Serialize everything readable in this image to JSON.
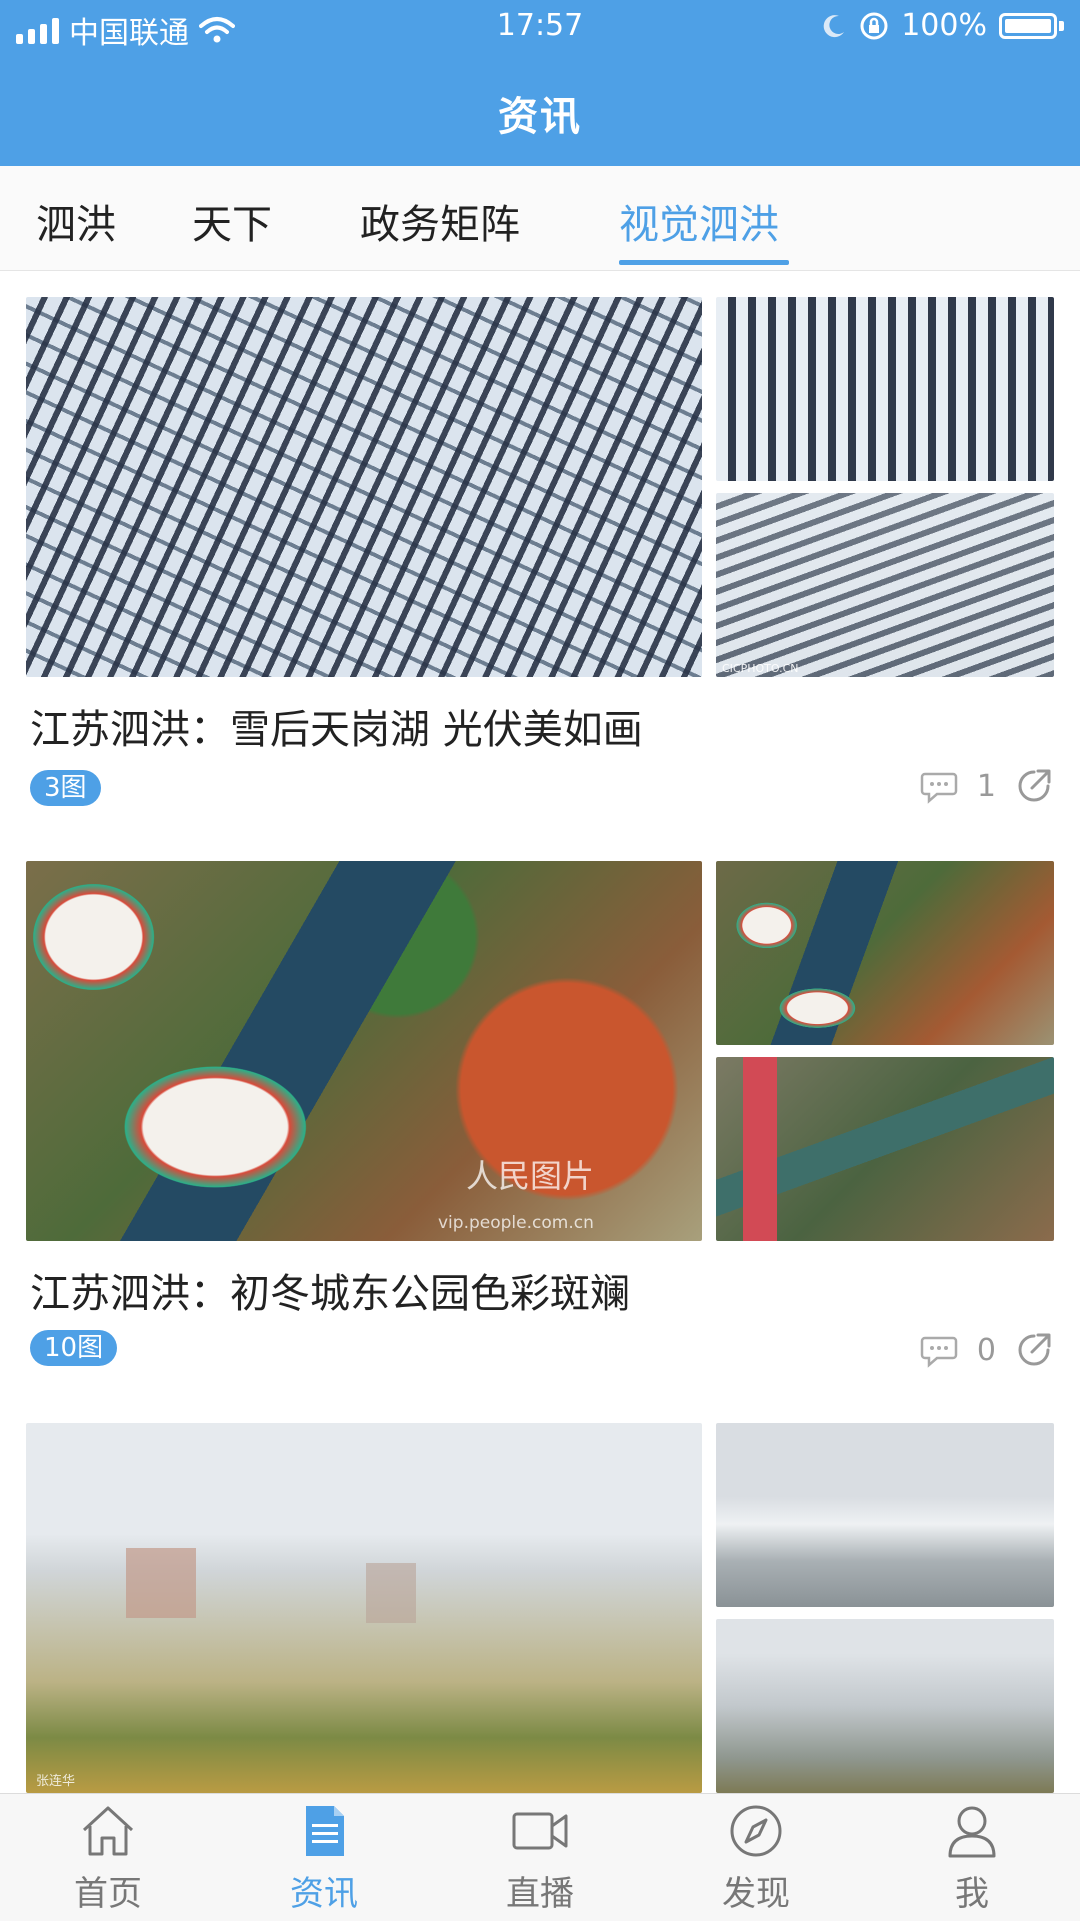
{
  "status_bar": {
    "carrier": "中国联通",
    "time": "17:57",
    "battery": "100%"
  },
  "header": {
    "title": "资讯"
  },
  "tabs": [
    {
      "label": "泗洪",
      "active": false
    },
    {
      "label": "天下",
      "active": false
    },
    {
      "label": "政务矩阵",
      "active": false
    },
    {
      "label": "视觉泗洪",
      "active": true
    }
  ],
  "articles": [
    {
      "title": "江苏泗洪：雪后天岗湖 光伏美如画",
      "badge": "3图",
      "comments": "1"
    },
    {
      "title": "江苏泗洪：初冬城东公园色彩斑斓",
      "badge": "10图",
      "comments": "0"
    }
  ],
  "image_marks": {
    "watermark_1": "CICPHOTO.CN",
    "watermark_2": "人民图片",
    "watermark_2_url": "vip.people.com.cn",
    "watermark_3": "张连华"
  },
  "bottom_nav": [
    {
      "label": "首页",
      "icon": "home-icon",
      "active": false
    },
    {
      "label": "资讯",
      "icon": "news-icon",
      "active": true
    },
    {
      "label": "直播",
      "icon": "video-camera-icon",
      "active": false
    },
    {
      "label": "发现",
      "icon": "compass-icon",
      "active": false
    },
    {
      "label": "我",
      "icon": "user-icon",
      "active": false
    }
  ],
  "colors": {
    "accent": "#4ea0e6",
    "text": "#222222",
    "muted": "#999999"
  }
}
